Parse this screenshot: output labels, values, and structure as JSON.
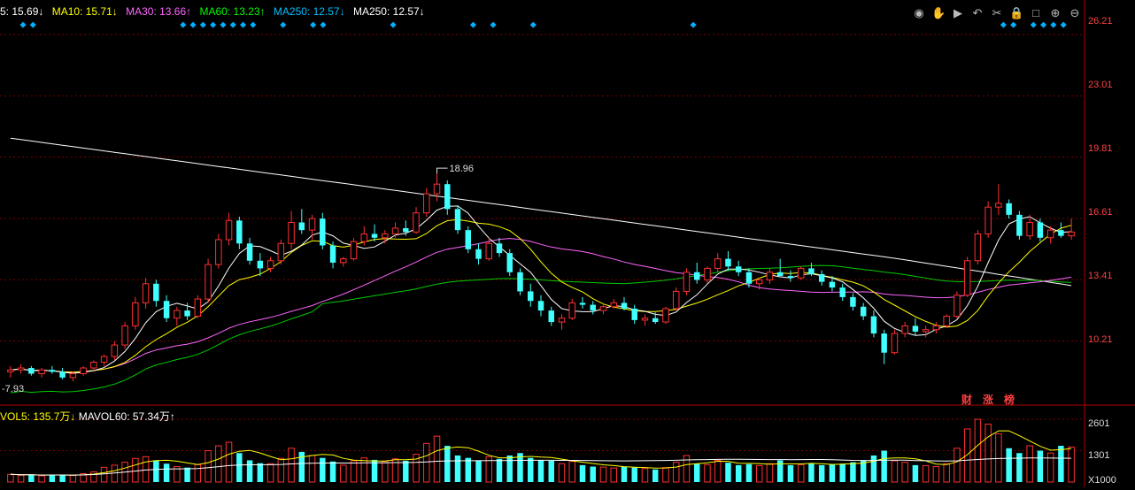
{
  "legend": {
    "ma5": "5: 15.69↓",
    "ma10": "MA10: 15.71↓",
    "ma30": "MA30: 13.66↑",
    "ma60": "MA60: 13.23↑",
    "ma250a": "MA250: 12.57↓",
    "ma250b": "MA250: 12.57↓",
    "colors": {
      "ma5": "#ffffff",
      "ma10": "#ffff00",
      "ma30": "#ff66ff",
      "ma60": "#00ff00",
      "ma250a": "#00c0ff",
      "ma250b": "#ffffff"
    }
  },
  "vol_legend": {
    "vol5": "VOL5: 135.7万↓",
    "mavol60": "MAVOL60: 57.34万↑"
  },
  "price_axis": [
    "26.21",
    "23.01",
    "19.81",
    "16.61",
    "13.41",
    "10.21"
  ],
  "volume_axis": [
    "2601",
    "1301",
    "X1000"
  ],
  "annotations": {
    "high": "18.96",
    "low": "7.93"
  },
  "badges": [
    "财",
    "涨",
    "榜"
  ],
  "toolbar_icons": [
    "eye-icon",
    "hand-icon",
    "play-icon",
    "undo-icon",
    "scissors-icon",
    "lock-icon",
    "square-icon",
    "zoom-in-icon",
    "zoom-out-icon"
  ],
  "chart_data": {
    "type": "candlestick",
    "ylim": [
      7.0,
      27.0
    ],
    "vol_max": 2601,
    "up_color": "#ff3030",
    "down_color": "#40ffff",
    "candles": [
      [
        8.6,
        8.9,
        8.3,
        8.7
      ],
      [
        8.7,
        9.0,
        8.5,
        8.8
      ],
      [
        8.8,
        8.9,
        8.4,
        8.5
      ],
      [
        8.5,
        8.8,
        8.3,
        8.7
      ],
      [
        8.7,
        8.9,
        8.5,
        8.6
      ],
      [
        8.6,
        8.8,
        8.2,
        8.3
      ],
      [
        8.3,
        8.6,
        8.1,
        8.5
      ],
      [
        8.5,
        8.9,
        8.4,
        8.8
      ],
      [
        8.8,
        9.2,
        8.6,
        9.1
      ],
      [
        9.1,
        9.5,
        8.9,
        9.4
      ],
      [
        9.4,
        10.2,
        9.2,
        10.0
      ],
      [
        10.0,
        11.2,
        9.8,
        11.0
      ],
      [
        11.0,
        12.5,
        10.8,
        12.2
      ],
      [
        12.2,
        13.5,
        11.9,
        13.2
      ],
      [
        13.2,
        13.4,
        12.0,
        12.3
      ],
      [
        12.3,
        12.6,
        11.2,
        11.4
      ],
      [
        11.4,
        12.0,
        11.0,
        11.8
      ],
      [
        11.8,
        12.2,
        11.3,
        11.5
      ],
      [
        11.5,
        12.6,
        11.4,
        12.4
      ],
      [
        12.4,
        14.5,
        12.2,
        14.2
      ],
      [
        14.2,
        15.8,
        14.0,
        15.5
      ],
      [
        15.5,
        16.9,
        15.2,
        16.5
      ],
      [
        16.5,
        16.7,
        15.0,
        15.3
      ],
      [
        15.3,
        15.6,
        14.2,
        14.4
      ],
      [
        14.4,
        14.8,
        13.6,
        14.0
      ],
      [
        14.0,
        14.6,
        13.8,
        14.4
      ],
      [
        14.4,
        15.5,
        14.2,
        15.3
      ],
      [
        15.3,
        17.0,
        15.0,
        16.4
      ],
      [
        16.4,
        17.1,
        15.8,
        16.0
      ],
      [
        16.0,
        16.8,
        15.5,
        16.6
      ],
      [
        16.6,
        16.9,
        15.0,
        15.2
      ],
      [
        15.2,
        15.4,
        14.0,
        14.3
      ],
      [
        14.3,
        14.6,
        14.1,
        14.5
      ],
      [
        14.5,
        15.6,
        14.4,
        15.4
      ],
      [
        15.4,
        16.2,
        15.2,
        15.8
      ],
      [
        15.8,
        16.3,
        15.4,
        15.6
      ],
      [
        15.6,
        16.0,
        15.3,
        15.8
      ],
      [
        15.8,
        16.4,
        15.6,
        16.1
      ],
      [
        16.1,
        16.5,
        15.7,
        15.9
      ],
      [
        15.9,
        17.2,
        15.8,
        16.9
      ],
      [
        16.9,
        18.2,
        16.7,
        17.9
      ],
      [
        17.9,
        18.96,
        17.5,
        18.4
      ],
      [
        18.4,
        18.6,
        16.8,
        17.1
      ],
      [
        17.1,
        17.3,
        15.8,
        16.0
      ],
      [
        16.0,
        16.2,
        14.8,
        15.0
      ],
      [
        15.0,
        15.3,
        14.2,
        14.5
      ],
      [
        14.5,
        15.6,
        14.4,
        15.3
      ],
      [
        15.3,
        15.6,
        14.6,
        14.8
      ],
      [
        14.8,
        15.0,
        13.6,
        13.8
      ],
      [
        13.8,
        14.0,
        12.6,
        12.8
      ],
      [
        12.8,
        13.2,
        12.0,
        12.3
      ],
      [
        12.3,
        12.6,
        11.5,
        11.8
      ],
      [
        11.8,
        12.0,
        11.0,
        11.2
      ],
      [
        11.2,
        11.6,
        10.8,
        11.4
      ],
      [
        11.4,
        12.4,
        11.3,
        12.2
      ],
      [
        12.2,
        12.5,
        11.9,
        12.1
      ],
      [
        12.1,
        12.3,
        11.6,
        11.8
      ],
      [
        11.8,
        12.2,
        11.6,
        12.0
      ],
      [
        12.0,
        12.4,
        11.9,
        12.2
      ],
      [
        12.2,
        12.5,
        11.8,
        11.9
      ],
      [
        11.9,
        12.1,
        11.1,
        11.3
      ],
      [
        11.3,
        11.6,
        11.0,
        11.4
      ],
      [
        11.4,
        11.7,
        11.1,
        11.2
      ],
      [
        11.2,
        12.0,
        11.1,
        11.9
      ],
      [
        11.9,
        13.0,
        11.8,
        12.8
      ],
      [
        12.8,
        14.0,
        12.6,
        13.8
      ],
      [
        13.8,
        14.3,
        13.2,
        13.4
      ],
      [
        13.4,
        14.1,
        13.2,
        14.0
      ],
      [
        14.0,
        14.8,
        13.8,
        14.5
      ],
      [
        14.5,
        14.9,
        13.9,
        14.1
      ],
      [
        14.1,
        14.4,
        13.6,
        13.8
      ],
      [
        13.8,
        14.0,
        13.0,
        13.2
      ],
      [
        13.2,
        13.5,
        12.9,
        13.4
      ],
      [
        13.4,
        14.0,
        13.2,
        13.8
      ],
      [
        13.8,
        14.5,
        13.6,
        13.6
      ],
      [
        13.6,
        13.9,
        13.3,
        13.5
      ],
      [
        13.5,
        14.1,
        13.4,
        14.0
      ],
      [
        14.0,
        14.3,
        13.6,
        13.7
      ],
      [
        13.7,
        13.9,
        13.1,
        13.3
      ],
      [
        13.3,
        13.6,
        12.8,
        13.0
      ],
      [
        13.0,
        13.2,
        12.3,
        12.5
      ],
      [
        12.5,
        12.7,
        11.8,
        12.0
      ],
      [
        12.0,
        12.2,
        11.3,
        11.5
      ],
      [
        11.5,
        11.8,
        10.4,
        10.6
      ],
      [
        10.6,
        10.8,
        9.0,
        9.6
      ],
      [
        9.6,
        10.8,
        9.5,
        10.6
      ],
      [
        10.6,
        11.2,
        10.4,
        11.0
      ],
      [
        11.0,
        11.4,
        10.5,
        10.7
      ],
      [
        10.7,
        11.0,
        10.4,
        10.8
      ],
      [
        10.8,
        11.2,
        10.6,
        11.0
      ],
      [
        11.0,
        11.6,
        10.9,
        11.5
      ],
      [
        11.5,
        12.8,
        11.4,
        12.6
      ],
      [
        12.6,
        14.6,
        12.5,
        14.4
      ],
      [
        14.4,
        16.0,
        14.2,
        15.8
      ],
      [
        15.8,
        17.5,
        15.6,
        17.2
      ],
      [
        17.2,
        18.4,
        16.8,
        17.4
      ],
      [
        17.4,
        17.6,
        16.6,
        16.8
      ],
      [
        16.8,
        17.0,
        15.5,
        15.7
      ],
      [
        15.7,
        16.8,
        15.5,
        16.4
      ],
      [
        16.4,
        16.6,
        15.4,
        15.6
      ],
      [
        15.6,
        16.2,
        15.3,
        16.0
      ],
      [
        16.0,
        16.4,
        15.6,
        15.7
      ],
      [
        15.7,
        16.6,
        15.5,
        15.9
      ]
    ],
    "volumes": [
      320,
      280,
      300,
      260,
      310,
      290,
      270,
      350,
      420,
      610,
      700,
      820,
      980,
      1050,
      900,
      760,
      640,
      600,
      720,
      1300,
      1500,
      1650,
      1200,
      900,
      780,
      760,
      980,
      1400,
      1250,
      1100,
      1000,
      850,
      700,
      880,
      1000,
      920,
      850,
      960,
      880,
      1150,
      1600,
      1900,
      1500,
      1100,
      1000,
      900,
      1050,
      960,
      1100,
      1200,
      1000,
      900,
      880,
      760,
      860,
      700,
      640,
      620,
      580,
      640,
      600,
      560,
      520,
      600,
      820,
      1100,
      760,
      720,
      900,
      800,
      700,
      740,
      680,
      760,
      900,
      700,
      720,
      780,
      700,
      740,
      760,
      820,
      900,
      1100,
      1300,
      880,
      820,
      700,
      680,
      640,
      760,
      1400,
      2200,
      2600,
      2400,
      2000,
      1400,
      1200,
      1500,
      1300,
      1200,
      1500,
      1450
    ]
  }
}
